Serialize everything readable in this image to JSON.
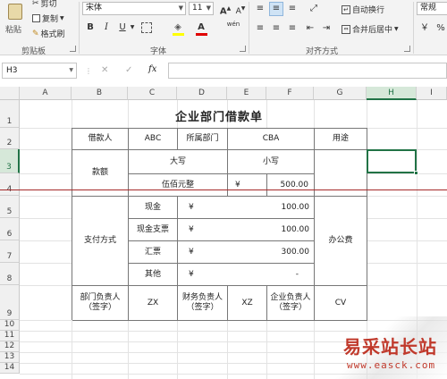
{
  "ribbon": {
    "paste": "粘贴",
    "cut": "剪切",
    "copy": "复制",
    "format_painter": "格式刷",
    "clipboard_group": "剪贴板",
    "font_name": "宋体",
    "font_size": "11",
    "grow_font": "A",
    "shrink_font": "A",
    "bold": "B",
    "italic": "I",
    "underline": "U",
    "font_color_letter": "A",
    "phonetic": "wén",
    "font_group": "字体",
    "wrap_text": "自动换行",
    "merge_center": "合并后居中",
    "alignment_group": "对齐方式",
    "number_format": "常规"
  },
  "formula_bar": {
    "name_box": "H3",
    "cancel": "✕",
    "enter": "✓",
    "fx": "fx",
    "value": ""
  },
  "sheet": {
    "columns": [
      "A",
      "B",
      "C",
      "D",
      "E",
      "F",
      "G",
      "H",
      "I"
    ],
    "rows": [
      "1",
      "2",
      "3",
      "4",
      "5",
      "6",
      "7",
      "8",
      "9",
      "10",
      "11",
      "12",
      "13",
      "14"
    ],
    "title": "企业部门借款单",
    "cells": {
      "b2": "借款人",
      "c2": "ABC",
      "d2": "所属部门",
      "ef2": "CBA",
      "g2": "用途",
      "b3": "款额",
      "cd3": "大写",
      "ef3": "小写",
      "cd4": "伍佰元整",
      "e4": "¥",
      "f4": "500.00",
      "b5": "支付方式",
      "c5": "现金",
      "d5": "¥",
      "f5": "100.00",
      "c6": "现金支票",
      "d6": "¥",
      "f6": "100.00",
      "c7": "汇票",
      "d7": "¥",
      "f7": "300.00",
      "c8": "其他",
      "d8": "¥",
      "f8": "-",
      "g5": "办公费",
      "b9": "部门负责人\n（签字）",
      "c9": "ZX",
      "d9": "财务负责人\n（签字）",
      "e9": "XZ",
      "f9": "企业负责人\n（签字）",
      "g9": "CV"
    }
  },
  "watermark": {
    "title": "易采站长站",
    "url": "www.easck.com"
  },
  "colors": {
    "selection": "#217346",
    "page_break_line": "#a52a2a",
    "watermark": "#c0392b",
    "active_align": "#cfe3f5"
  }
}
